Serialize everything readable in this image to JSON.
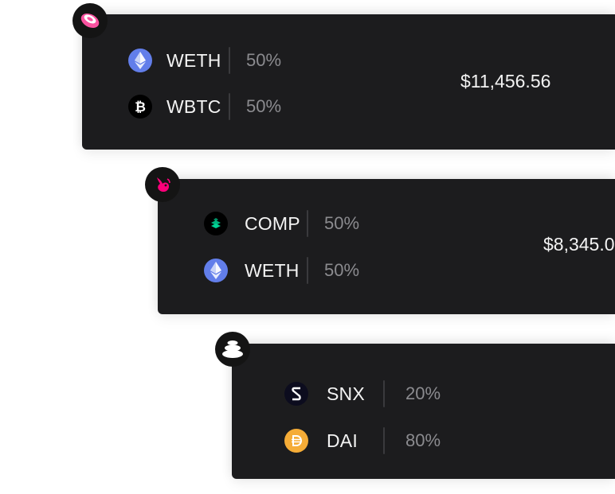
{
  "pools": [
    {
      "platform_icon": "sushiswap-logo-icon",
      "value": "$11,456.56",
      "tokens": [
        {
          "symbol": "WETH",
          "weight": "50%",
          "icon": "ethereum-icon"
        },
        {
          "symbol": "WBTC",
          "weight": "50%",
          "icon": "bitcoin-icon"
        }
      ]
    },
    {
      "platform_icon": "uniswap-logo-icon",
      "value": "$8,345.0",
      "tokens": [
        {
          "symbol": "COMP",
          "weight": "50%",
          "icon": "compound-icon"
        },
        {
          "symbol": "WETH",
          "weight": "50%",
          "icon": "ethereum-icon"
        }
      ]
    },
    {
      "platform_icon": "balancer-logo-icon",
      "tokens": [
        {
          "symbol": "SNX",
          "weight": "20%",
          "icon": "synthetix-icon"
        },
        {
          "symbol": "DAI",
          "weight": "80%",
          "icon": "dai-icon"
        }
      ]
    }
  ],
  "colors": {
    "card_bg": "#1c1c1e",
    "text": "#f3f3f3",
    "muted": "#8b8b8f",
    "ethereum": "#627eea",
    "compound": "#00d395",
    "dai": "#f5ac37",
    "sushi_pink": "#fa52a0",
    "uniswap_pink": "#ff007a"
  }
}
